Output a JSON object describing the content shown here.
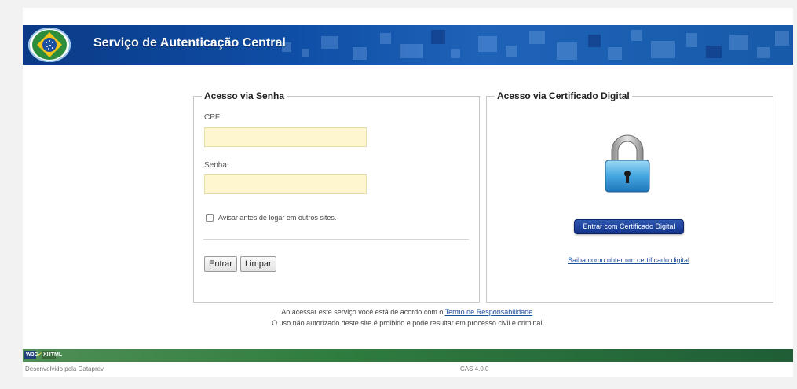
{
  "header": {
    "title": "Serviço de Autenticação Central",
    "accent": "#0f4ea6"
  },
  "login": {
    "legend": "Acesso via Senha",
    "cpf_label": "CPF:",
    "cpf_value": "",
    "password_label": "Senha:",
    "password_value": "",
    "warn_label": "Avisar antes de logar em outros sites.",
    "warn_checked": false,
    "submit_label": "Entrar",
    "clear_label": "Limpar"
  },
  "certificate": {
    "legend": "Acesso via Certificado Digital",
    "icon": "lock-icon",
    "button_label": "Entrar com Certificado Digital",
    "help_link": "Saiba como obter um certificado digital"
  },
  "notice": {
    "line1_prefix": "Ao acessar este serviço você está de acordo com o",
    "line1_link": "Termo de Responsabilidade",
    "line1_suffix": ".",
    "line2": "O uso não autorizado deste site é proibido e pode resultar em processo civil e criminal."
  },
  "footer": {
    "badges": [
      "W3C",
      "✓",
      "XHTML"
    ],
    "developer": "Desenvolvido pela Dataprev",
    "version": "CAS 4.0.0",
    "bar_color": "#2f7d3f"
  }
}
